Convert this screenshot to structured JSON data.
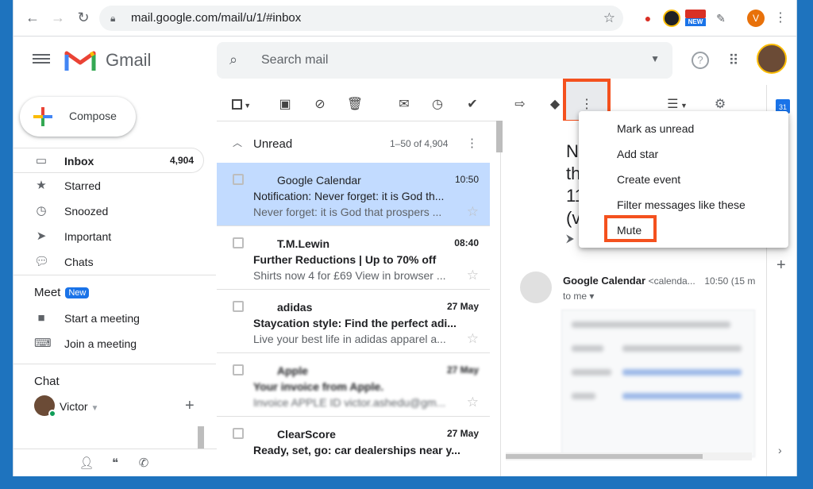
{
  "browser": {
    "url": "mail.google.com/mail/u/1/#inbox",
    "ext_badge": "NEW",
    "profile_letter": "V"
  },
  "header": {
    "app_name": "Gmail",
    "search_placeholder": "Search mail"
  },
  "nav": {
    "compose_label": "Compose",
    "items": [
      {
        "label": "Inbox",
        "count": "4,904"
      },
      {
        "label": "Starred",
        "count": ""
      },
      {
        "label": "Snoozed",
        "count": ""
      },
      {
        "label": "Important",
        "count": ""
      },
      {
        "label": "Chats",
        "count": ""
      }
    ],
    "meet": {
      "title": "Meet",
      "badge": "New",
      "items": [
        "Start a meeting",
        "Join a meeting"
      ]
    },
    "chat": {
      "title": "Chat",
      "user": "Victor"
    }
  },
  "list": {
    "section": "Unread",
    "range": "1–50 of 4,904",
    "rows": [
      {
        "from": "Google Calendar",
        "time": "10:50",
        "subject": "Notification: Never forget: it is God th...",
        "snippet": "Never forget: it is God that prospers ...",
        "unread": false,
        "selected": true
      },
      {
        "from": "T.M.Lewin",
        "time": "08:40",
        "subject": "Further Reductions | Up to 70% off",
        "snippet": "Shirts now 4 for £69 View in browser ...",
        "unread": true,
        "selected": false
      },
      {
        "from": "adidas",
        "time": "27 May",
        "subject": "Staycation style: Find the perfect adi...",
        "snippet": "Live your best life in adidas apparel a...",
        "unread": true,
        "selected": false
      },
      {
        "from": "Apple",
        "time": "27 May",
        "subject": "Your invoice from Apple.",
        "snippet": "Invoice APPLE ID victor.ashedu@gm...",
        "unread": true,
        "selected": false
      },
      {
        "from": "ClearScore",
        "time": "27 May",
        "subject": "Ready, set, go: car dealerships near y...",
        "snippet": "",
        "unread": true,
        "selected": false
      }
    ]
  },
  "reading": {
    "title_lines": [
      "No",
      "th",
      "11:",
      "(v"
    ],
    "sender": "Google Calendar",
    "sender_email": "<calenda...",
    "time": "10:50 (15 m",
    "to": "to me"
  },
  "menu": {
    "items": [
      "Mark as unread",
      "Add star",
      "Create event",
      "Filter messages like these",
      "Mute"
    ]
  },
  "colors": {
    "highlight": "#f4511e",
    "selected_row": "#c2dbff",
    "accent": "#1a73e8"
  }
}
